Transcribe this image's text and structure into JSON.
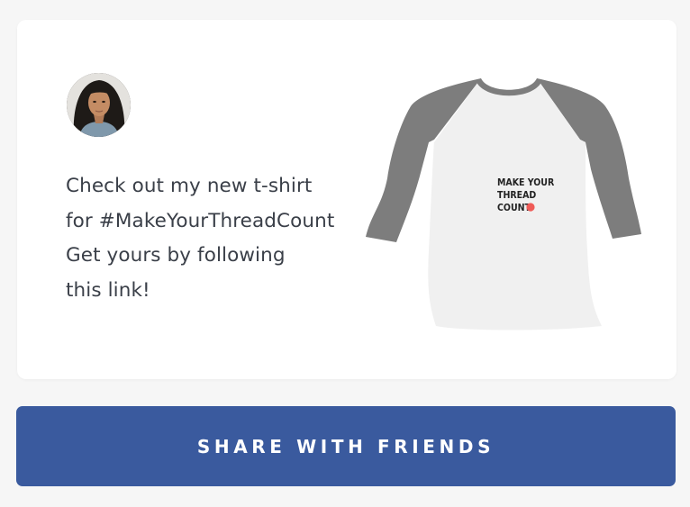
{
  "card": {
    "message_lines": [
      "Check out my new t-shirt",
      "for #MakeYourThreadCount",
      "Get yours by following",
      "this link!"
    ]
  },
  "product": {
    "shirt_print": [
      "MAKE YOUR",
      "THREAD",
      "COUNT"
    ],
    "colors": {
      "body": "#f0f0f0",
      "sleeves": "#7d7d7d",
      "dot": "#ef5b57"
    }
  },
  "share": {
    "label": "SHARE WITH FRIENDS",
    "color": "#3a5a9e"
  }
}
